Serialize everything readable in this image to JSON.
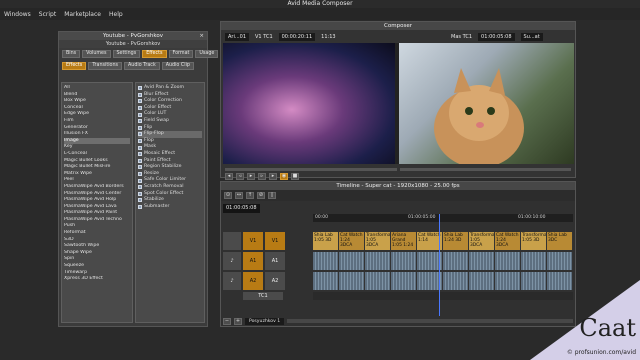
{
  "app": {
    "title": "Avid Media Composer"
  },
  "menu": [
    "Windows",
    "Script",
    "Marketplace",
    "Help"
  ],
  "effect_palette": {
    "title": "Youtube - PvGorshkov",
    "subtitle": "Youtube - PvGorshkov",
    "tabs": [
      "Bins",
      "Volumes",
      "Settings",
      "Effects",
      "Format",
      "Usage",
      "Info"
    ],
    "subtabs": [
      "Effects",
      "Transitions",
      "Audio Track",
      "Audio Clip"
    ],
    "active_tab": "Effects",
    "categories": [
      "All",
      "Blend",
      "Box Wipe",
      "Conceal",
      "Edge Wipe",
      "Film",
      "Generator",
      "Illusion FX",
      "Image",
      "Key",
      "L-Conceal",
      "Magic Bullet Looks",
      "Magic Bullet MisFire",
      "Matrix Wipe",
      "Peel",
      "PlasmaWipe Avid Borders",
      "PlasmaWipe Avid Center",
      "PlasmaWipe Avid Holp",
      "PlasmaWipe Avid Lava",
      "PlasmaWipe Avid Paint",
      "PlasmaWipe Avid Techno",
      "Push",
      "Reformat",
      "S3D",
      "Sawtooth Wipe",
      "Shape Wipe",
      "Spin",
      "Squeeze",
      "Timewarp",
      "Xpress 3D Effect"
    ],
    "selected_category": "Image",
    "effects": [
      "Avid Pan & Zoom",
      "Blur Effect",
      "Color Correction",
      "Color Effect",
      "Color LUT",
      "Field Swap",
      "Flip",
      "Flip-Flop",
      "Flop",
      "Mask",
      "Mosaic Effect",
      "Paint Effect",
      "Region Stabilize",
      "Resize",
      "Safe Color Limiter",
      "Scratch Removal",
      "Spot Color Effect",
      "Stabilize",
      "Submaster"
    ],
    "selected_effect": "Flip-Flop"
  },
  "composer": {
    "title": "Composer",
    "source_clip": "Ari...01",
    "track": "V1 TC1",
    "src_tc": "00:00:20:11",
    "src_dur": "11:13",
    "mas_label": "Mas TC1",
    "rec_tc": "01:00:05:08",
    "rec_clip": "Su...at"
  },
  "timeline": {
    "title": "Timeline - Super cat - 1920x1080 - 25.00 fps",
    "timecode": "01:00:05:08",
    "ruler": [
      "00:00",
      "01:00:05:00",
      "01:00:10:00"
    ],
    "tracks": [
      {
        "name": "V1",
        "label": "V1"
      },
      {
        "name": "A1",
        "label": "A1"
      },
      {
        "name": "A2",
        "label": "A2"
      },
      {
        "name": "TC1",
        "label": "TC1"
      }
    ],
    "video_clips": [
      "Shia Lab 1:05 3D",
      "Cat Watch 1:24 3DCA",
      "Transforma 1:05 3DCA",
      "Ariana Grand 1:05 1:24",
      "Cat Watch 1:14",
      "Shia Lab 1:24 3D",
      "Transforma 1:05 3DCA",
      "Cat Watch 1:24 3DCA",
      "Transforma 1:05 3D",
      "Shia Lab 3DC"
    ],
    "sequence": "Posyuzhkov 1"
  },
  "brand": {
    "logo": "Caat",
    "url": "© profsunion.com/avid"
  }
}
